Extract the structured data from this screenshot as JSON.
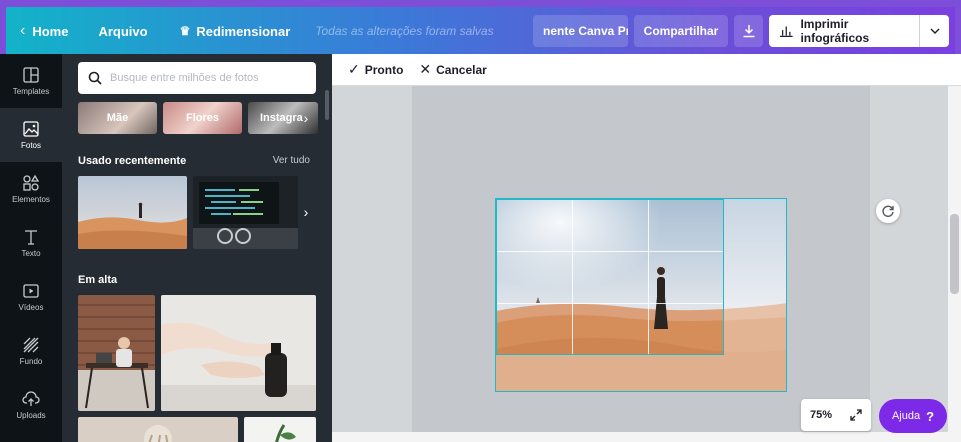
{
  "topbar": {
    "home_label": "Home",
    "file_label": "Arquivo",
    "resize_label": "Redimensionar",
    "saved_status": "Todas as alterações foram salvas",
    "pro_label": "nente Canva Pro",
    "share_label": "Compartilhar",
    "print_label": "Imprimir infográficos",
    "download_icon": "download-icon",
    "colors": {
      "gradient_start": "#12b3c9",
      "gradient_end": "#7b3fe0",
      "frame": "#7d4fd8"
    }
  },
  "rail": {
    "items": [
      {
        "label": "Templates",
        "icon": "templates-icon",
        "active": false
      },
      {
        "label": "Fotos",
        "icon": "photos-icon",
        "active": true
      },
      {
        "label": "Elementos",
        "icon": "elements-icon",
        "active": false
      },
      {
        "label": "Texto",
        "icon": "text-icon",
        "active": false
      },
      {
        "label": "Vídeos",
        "icon": "video-icon",
        "active": false
      },
      {
        "label": "Fundo",
        "icon": "background-icon",
        "active": false
      },
      {
        "label": "Uploads",
        "icon": "uploads-icon",
        "active": false
      }
    ]
  },
  "panel": {
    "search_placeholder": "Busque entre milhões de fotos",
    "chips": [
      "Mãe",
      "Flores",
      "Instagra"
    ],
    "recent_title": "Usado recentemente",
    "see_all": "Ver tudo",
    "trending_title": "Em alta"
  },
  "editor": {
    "done_label": "Pronto",
    "cancel_label": "Cancelar",
    "zoom": "75%",
    "help_label": "Ajuda",
    "help_mark": "?",
    "accent": "#22b8c8"
  }
}
